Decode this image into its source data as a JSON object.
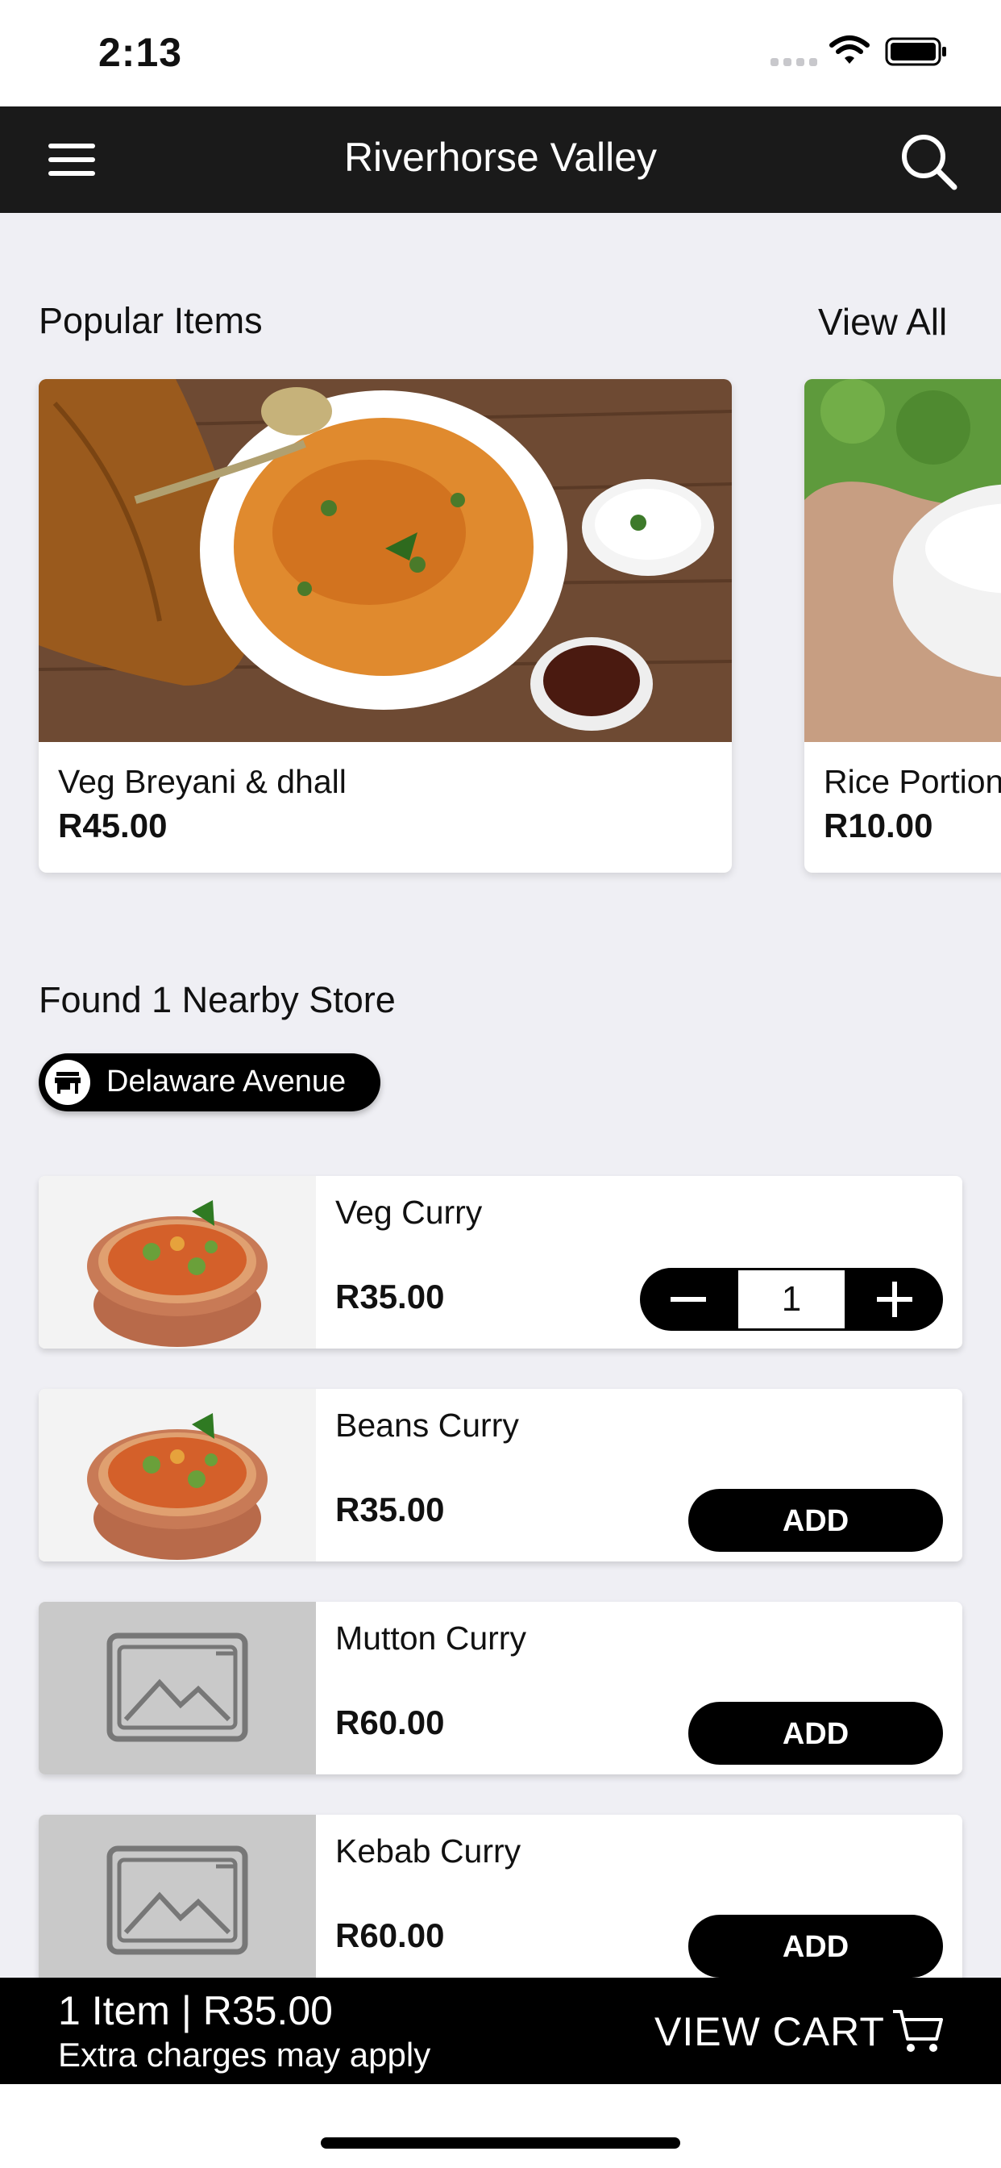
{
  "status_bar": {
    "time": "2:13"
  },
  "header": {
    "title": "Riverhorse Valley"
  },
  "popular": {
    "title": "Popular Items",
    "view_all": "View All",
    "items": [
      {
        "name": "Veg Breyani & dhall",
        "price": "R45.00"
      },
      {
        "name": "Rice Portion",
        "price": "R10.00"
      }
    ]
  },
  "nearby": {
    "title": "Found 1 Nearby Store",
    "store": "Delaware Avenue"
  },
  "menu_items": [
    {
      "name": "Veg Curry",
      "price": "R35.00",
      "quantity": "1"
    },
    {
      "name": "Beans Curry",
      "price": "R35.00",
      "action": "ADD"
    },
    {
      "name": "Mutton Curry",
      "price": "R60.00",
      "action": "ADD"
    },
    {
      "name": "Kebab Curry",
      "price": "R60.00",
      "action": "ADD"
    }
  ],
  "cart": {
    "summary": "1 Item | R35.00",
    "note": "Extra charges may apply",
    "button": "VIEW CART"
  },
  "colors": {
    "bar": "#1a1a1a",
    "background": "#efeff4",
    "accent": "#000000"
  }
}
